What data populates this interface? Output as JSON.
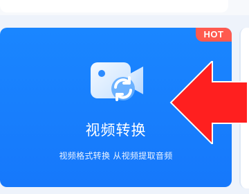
{
  "top_strip": {},
  "feature_card": {
    "badge": "HOT",
    "title": "视频转换",
    "subtitle": "视频格式转换 从视频提取音频",
    "icon": "video-convert-icon",
    "color_primary": "#1a86ff",
    "badge_color": "#ff5a4f"
  },
  "annotation": {
    "arrow_icon": "red-arrow-icon",
    "arrow_color": "#ff1f1f"
  }
}
